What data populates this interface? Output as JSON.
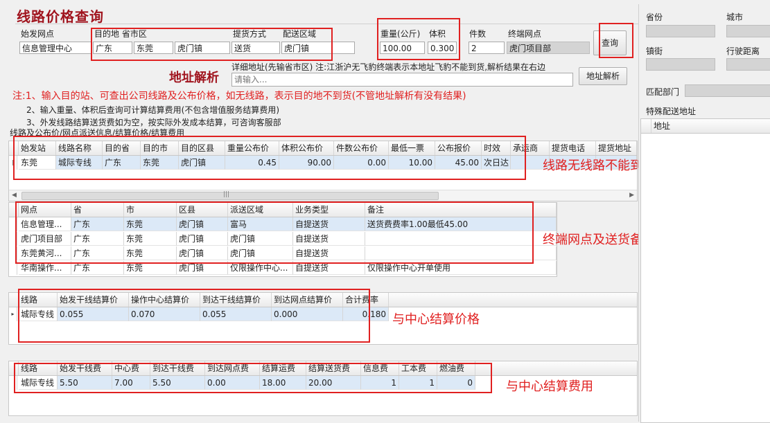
{
  "header": {
    "title": "线路价格查询"
  },
  "query": {
    "origin_label": "始发网点",
    "origin_value": "信息管理中心",
    "dest_label": "目的地 省市区",
    "dest_province": "广东",
    "dest_city": "东莞",
    "dest_district": "虎门镇",
    "pickup_label": "提货方式",
    "pickup_value": "送货",
    "delivery_area_label": "配送区域",
    "delivery_area_value": "虎门镇",
    "weight_label": "重量(公斤)",
    "weight_value": "100.00",
    "volume_label": "体积",
    "volume_value": "0.300",
    "pieces_label": "件数",
    "pieces_value": "2",
    "terminal_label": "终端网点",
    "terminal_value": "虎门项目部",
    "query_button": "查询"
  },
  "address_parse": {
    "heading": "地址解析",
    "hint": "详细地址(先输省市区) 注:江浙沪无飞豹终端表示本地址飞豹不能到货,解析结果在右边",
    "placeholder": "请输入...",
    "button": "地址解析"
  },
  "notes": {
    "line1": "注:1、输入目的站、可查出公司线路及公布价格，如无线路，表示目的地不到货(不管地址解析有没有结果)",
    "line2": "2、输入重量、体积后查询可计算结算费用(不包含增值服务结算费用)",
    "line3": "3、外发线路结算送货费如为空，按实际外发成本结算，可咨询客服部",
    "section_caption": "线路及公布价/网点派送信息/结算价格/结算费用"
  },
  "route_table": {
    "columns": [
      "始发站",
      "线路名称",
      "目的省",
      "目的市",
      "目的区县",
      "重量公布价",
      "体积公布价",
      "件数公布价",
      "最低一票",
      "公布报价",
      "时效",
      "承运商",
      "提货电话",
      "提货地址"
    ],
    "rows": [
      [
        "东莞",
        "城际专线",
        "广东",
        "东莞",
        "虎门镇",
        "0.45",
        "90.00",
        "0.00",
        "10.00",
        "45.00",
        "次日达",
        "",
        "",
        ""
      ]
    ]
  },
  "outlet_table": {
    "columns": [
      "网点",
      "省",
      "市",
      "区县",
      "派送区域",
      "业务类型",
      "备注"
    ],
    "rows": [
      [
        "信息管理...",
        "广东",
        "东莞",
        "虎门镇",
        "富马",
        "自提送货",
        "送货费费率1.00最低45.00"
      ],
      [
        "虎门项目部",
        "广东",
        "东莞",
        "虎门镇",
        "虎门镇",
        "自提送货",
        ""
      ],
      [
        "东莞黄河...",
        "广东",
        "东莞",
        "虎门镇",
        "虎门镇",
        "自提送货",
        ""
      ],
      [
        "华南操作...",
        "广东",
        "东莞",
        "虎门镇",
        "仅限操作中心...",
        "自提送货",
        "仅限操作中心开单使用"
      ]
    ]
  },
  "settle_price_table": {
    "columns": [
      "线路",
      "始发干线结算价",
      "操作中心结算价",
      "到达干线结算价",
      "到达网点结算价",
      "合计费率"
    ],
    "rows": [
      [
        "城际专线",
        "0.055",
        "0.070",
        "0.055",
        "0.000",
        "0.180"
      ]
    ]
  },
  "settle_fee_table": {
    "columns": [
      "线路",
      "始发干线费",
      "中心费",
      "到达干线费",
      "到达网点费",
      "结算运费",
      "结算送货费",
      "信息费",
      "工本费",
      "燃油费"
    ],
    "rows": [
      [
        "城际专线",
        "5.50",
        "7.00",
        "5.50",
        "0.00",
        "18.00",
        "20.00",
        "1",
        "1",
        "0"
      ]
    ]
  },
  "annotations": {
    "no_route": "线路无线路不能到货",
    "outlet_note": "终端网点及送货备注",
    "center_price": "与中心结算价格",
    "center_fee": "与中心结算费用"
  },
  "right_panel": {
    "province_label": "省份",
    "city_label": "城市",
    "town_label": "镇街",
    "distance_label": "行驶距离",
    "match_dept_label": "匹配部门",
    "special_addr_label": "特殊配送地址",
    "address_col": "地址"
  },
  "colors": {
    "annotation_red": "#e02020",
    "title_red": "#a0141e"
  }
}
